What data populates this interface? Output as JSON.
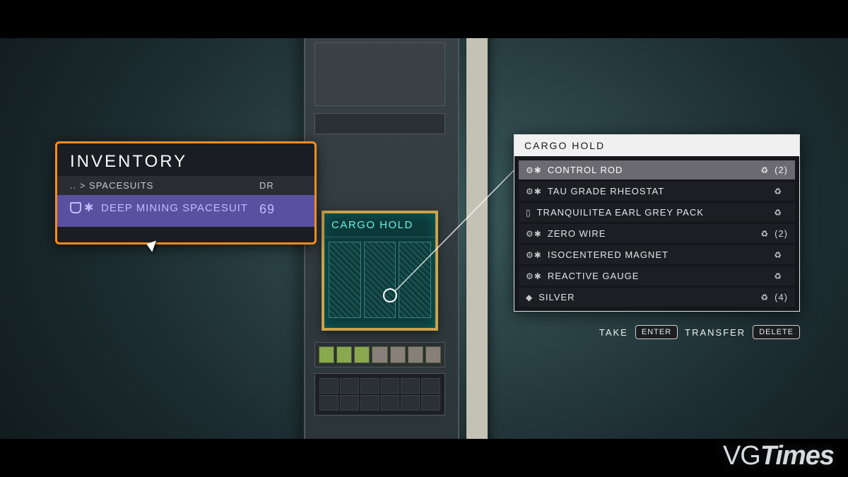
{
  "inventory": {
    "title": "INVENTORY",
    "breadcrumb": ".. > SPACESUITS",
    "stat_header": "DR",
    "selected": {
      "name": "DEEP MINING SPACESUIT",
      "dr": "69"
    }
  },
  "terminal": {
    "label": "CARGO HOLD"
  },
  "cargo": {
    "title": "CARGO HOLD",
    "items": [
      {
        "icon": "⚙✱",
        "name": "CONTROL ROD",
        "recyclable": true,
        "qty": "(2)",
        "selected": true
      },
      {
        "icon": "⚙✱",
        "name": "TAU GRADE RHEOSTAT",
        "recyclable": true,
        "qty": "",
        "selected": false
      },
      {
        "icon": "▯",
        "name": "TRANQUILITEA EARL GREY PACK",
        "recyclable": true,
        "qty": "",
        "selected": false
      },
      {
        "icon": "⚙✱",
        "name": "ZERO WIRE",
        "recyclable": true,
        "qty": "(2)",
        "selected": false
      },
      {
        "icon": "⚙✱",
        "name": "ISOCENTERED MAGNET",
        "recyclable": true,
        "qty": "",
        "selected": false
      },
      {
        "icon": "⚙✱",
        "name": "REACTIVE GAUGE",
        "recyclable": true,
        "qty": "",
        "selected": false
      },
      {
        "icon": "◆",
        "name": "SILVER",
        "recyclable": true,
        "qty": "(4)",
        "selected": false
      }
    ]
  },
  "actions": {
    "take_label": "TAKE",
    "take_key": "ENTER",
    "transfer_label": "TRANSFER",
    "transfer_key": "DELETE"
  },
  "watermark": "VGTimes"
}
